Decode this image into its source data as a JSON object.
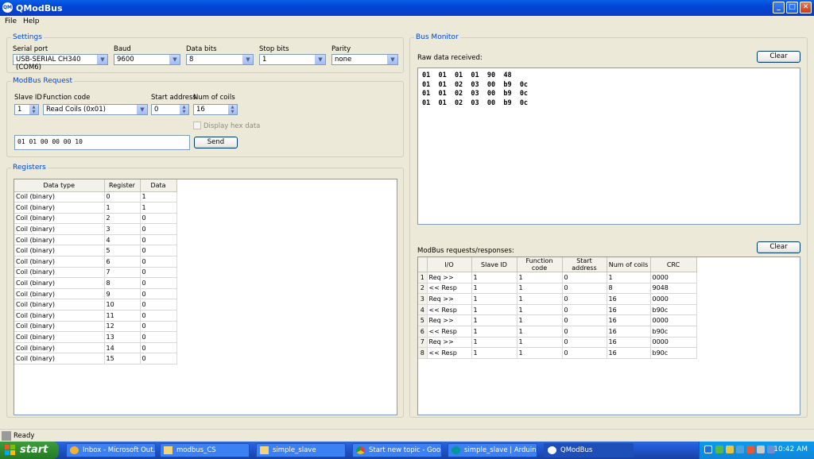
{
  "window": {
    "title": "QModBus",
    "icon_text": "QM"
  },
  "menu": [
    "File",
    "Help"
  ],
  "settings": {
    "title": "Settings",
    "serial_port": {
      "label": "Serial port",
      "value": "USB-SERIAL CH340 (COM6)"
    },
    "baud": {
      "label": "Baud",
      "value": "9600"
    },
    "data_bits": {
      "label": "Data bits",
      "value": "8"
    },
    "stop_bits": {
      "label": "Stop bits",
      "value": "1"
    },
    "parity": {
      "label": "Parity",
      "value": "none"
    }
  },
  "request": {
    "title": "ModBus Request",
    "slave_id": {
      "label": "Slave ID",
      "value": "1"
    },
    "function_code": {
      "label": "Function code",
      "value": "Read Coils (0x01)"
    },
    "start_address": {
      "label": "Start address",
      "value": "0"
    },
    "num_coils": {
      "label": "Num of coils",
      "value": "16"
    },
    "display_hex_label": "Display hex data",
    "raw_request": "01  01  00 00  00 10",
    "send_label": "Send"
  },
  "registers": {
    "title": "Registers",
    "columns": [
      "Data type",
      "Register",
      "Data"
    ],
    "rows": [
      [
        "Coil (binary)",
        "0",
        "1"
      ],
      [
        "Coil (binary)",
        "1",
        "1"
      ],
      [
        "Coil (binary)",
        "2",
        "0"
      ],
      [
        "Coil (binary)",
        "3",
        "0"
      ],
      [
        "Coil (binary)",
        "4",
        "0"
      ],
      [
        "Coil (binary)",
        "5",
        "0"
      ],
      [
        "Coil (binary)",
        "6",
        "0"
      ],
      [
        "Coil (binary)",
        "7",
        "0"
      ],
      [
        "Coil (binary)",
        "8",
        "0"
      ],
      [
        "Coil (binary)",
        "9",
        "0"
      ],
      [
        "Coil (binary)",
        "10",
        "0"
      ],
      [
        "Coil (binary)",
        "11",
        "0"
      ],
      [
        "Coil (binary)",
        "12",
        "0"
      ],
      [
        "Coil (binary)",
        "13",
        "0"
      ],
      [
        "Coil (binary)",
        "14",
        "0"
      ],
      [
        "Coil (binary)",
        "15",
        "0"
      ]
    ]
  },
  "bus_monitor": {
    "title": "Bus Monitor",
    "raw_label": "Raw data received:",
    "clear_label": "Clear",
    "raw_lines": [
      "01  01  01  01  90  48",
      "01  01  02  03  00  b9  0c",
      "01  01  02  03  00  b9  0c",
      "01  01  02  03  00  b9  0c"
    ],
    "rr_label": "ModBus requests/responses:",
    "rr_clear_label": "Clear",
    "rr_columns": [
      "I/O",
      "Slave ID",
      "Function code",
      "Start address",
      "Num of coils",
      "CRC"
    ],
    "rr_rows": [
      [
        "1",
        "Req >>",
        "1",
        "1",
        "0",
        "1",
        "0000"
      ],
      [
        "2",
        "<< Resp",
        "1",
        "1",
        "0",
        "8",
        "9048"
      ],
      [
        "3",
        "Req >>",
        "1",
        "1",
        "0",
        "16",
        "0000"
      ],
      [
        "4",
        "<< Resp",
        "1",
        "1",
        "0",
        "16",
        "b90c"
      ],
      [
        "5",
        "Req >>",
        "1",
        "1",
        "0",
        "16",
        "0000"
      ],
      [
        "6",
        "<< Resp",
        "1",
        "1",
        "0",
        "16",
        "b90c"
      ],
      [
        "7",
        "Req >>",
        "1",
        "1",
        "0",
        "16",
        "0000"
      ],
      [
        "8",
        "<< Resp",
        "1",
        "1",
        "0",
        "16",
        "b90c"
      ]
    ]
  },
  "status": "Ready",
  "taskbar": {
    "start_label": "start",
    "tasks": [
      {
        "label": "Inbox - Microsoft Out...",
        "icon": "outlook-icon"
      },
      {
        "label": "modbus_CS",
        "icon": "folder-icon"
      },
      {
        "label": "simple_slave",
        "icon": "folder-icon"
      },
      {
        "label": "Start new topic - Goo...",
        "icon": "chrome-icon"
      },
      {
        "label": "simple_slave | Arduin...",
        "icon": "arduino-icon"
      },
      {
        "label": "QModBus",
        "icon": "qmodbus-icon"
      }
    ],
    "clock": "10:42 AM"
  }
}
